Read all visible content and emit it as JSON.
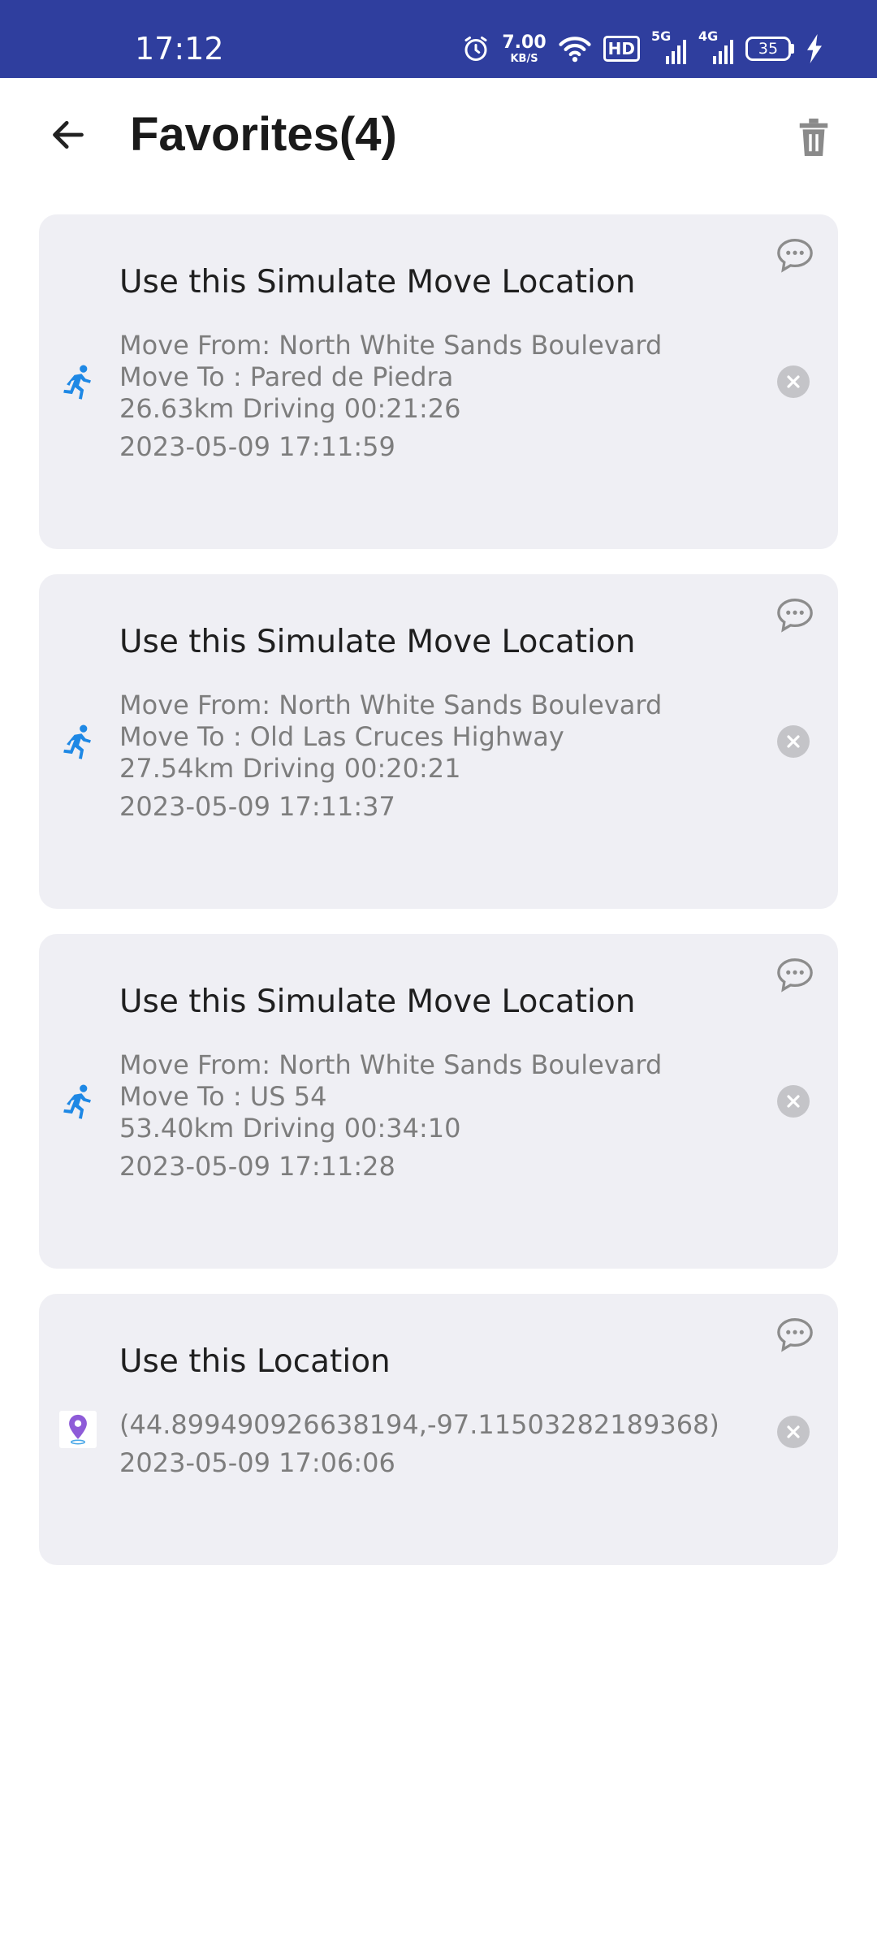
{
  "status_bar": {
    "time": "17:12",
    "net_speed_value": "7.00",
    "net_speed_unit": "KB/S",
    "hd_label": "HD",
    "signal1_label": "5G",
    "signal2_label": "4G",
    "battery_level": "35",
    "icons": [
      "alarm-icon",
      "wifi-icon",
      "signal-icon",
      "battery-icon",
      "charging-icon"
    ]
  },
  "header": {
    "title": "Favorites(4)",
    "back_icon": "arrow-left-icon",
    "delete_icon": "trash-icon"
  },
  "favorites": [
    {
      "title": "Use this Simulate Move Location",
      "type_icon": "running-person-icon",
      "lines": [
        "Move From: North White Sands Boulevard",
        "Move To : Pared de Piedra",
        "26.63km Driving 00:21:26"
      ],
      "date": "2023-05-09 17:11:59"
    },
    {
      "title": "Use this Simulate Move Location",
      "type_icon": "running-person-icon",
      "lines": [
        "Move From: North White Sands Boulevard",
        "Move To : Old Las Cruces Highway",
        "27.54km Driving 00:20:21"
      ],
      "date": "2023-05-09 17:11:37"
    },
    {
      "title": "Use this Simulate Move Location",
      "type_icon": "running-person-icon",
      "lines": [
        "Move From: North White Sands Boulevard",
        "Move To : US 54",
        "53.40km Driving 00:34:10"
      ],
      "date": "2023-05-09 17:11:28"
    },
    {
      "title": "Use this Location",
      "type_icon": "location-pin-icon",
      "lines": [
        "(44.899490926638194,-97.11503282189368)"
      ],
      "date": "2023-05-09 17:06:06"
    }
  ],
  "colors": {
    "status_bar": "#2f3e9e",
    "card_background": "#efeff4",
    "run_icon": "#1e88e5",
    "pin_icon": "#8e5bd8"
  }
}
